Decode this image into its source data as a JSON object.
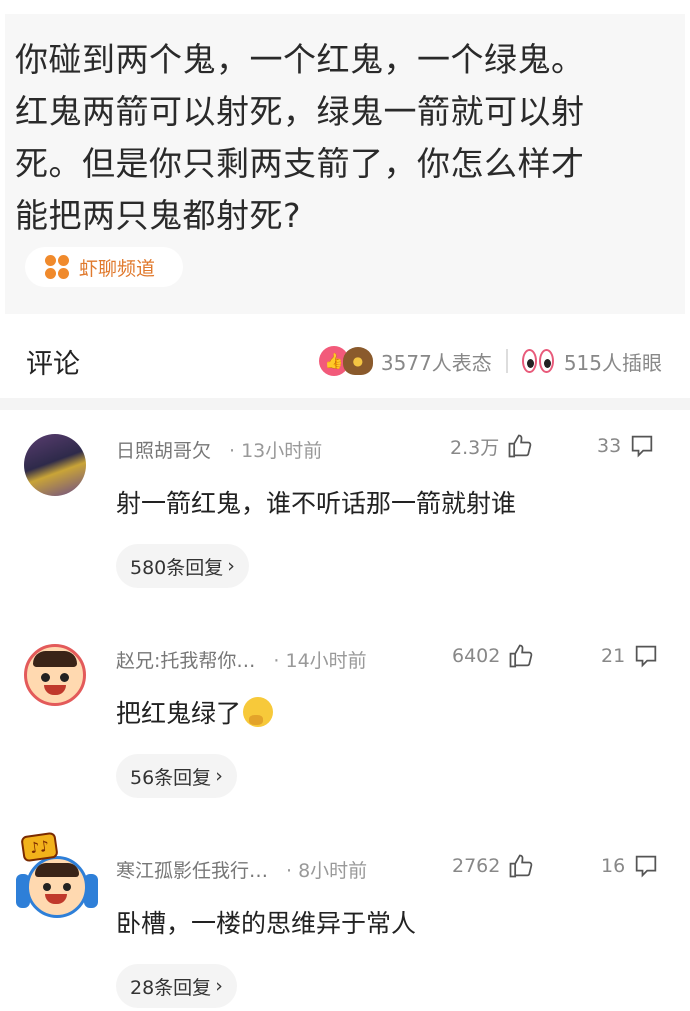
{
  "post": {
    "text": "你碰到两个鬼，一个红鬼，一个绿鬼。\n红鬼两箭可以射死，绿鬼一箭就可以射\n死。但是你只剩两支箭了，你怎么样才\n能把两只鬼都射死?",
    "channel_label": "虾聊频道"
  },
  "comments_bar": {
    "heading": "评论",
    "reaction_count": "3577人表态",
    "eye_count": "515人插眼"
  },
  "comments": [
    {
      "username": "日照胡哥欠",
      "time": "· 13小时前",
      "likes": "2.3万",
      "replies_count": "33",
      "text": "射一箭红鬼，谁不听话那一箭就射谁",
      "replies_label": "580条回复",
      "avatar_icon": "photo-avatar"
    },
    {
      "username": "赵兄:托我帮你…",
      "time": "· 14小时前",
      "likes": "6402",
      "replies_count": "21",
      "text": "把红鬼绿了",
      "replies_label": "56条回复",
      "avatar_icon": "cartoon-face-avatar"
    },
    {
      "username": "寒江孤影任我行…",
      "time": "· 8小时前",
      "likes": "2762",
      "replies_count": "16",
      "text": "卧槽，一楼的思维异于常人",
      "replies_label": "28条回复",
      "avatar_icon": "cartoon-headphones-avatar"
    }
  ],
  "icons": {
    "channel": "orange-flower-icon",
    "like": "thumbs-up-icon",
    "reply": "speech-bubble-icon",
    "chevron": "chevron-right-icon"
  },
  "colors": {
    "accent_orange": "#e07a2e",
    "like_pink": "#f25a7a"
  }
}
